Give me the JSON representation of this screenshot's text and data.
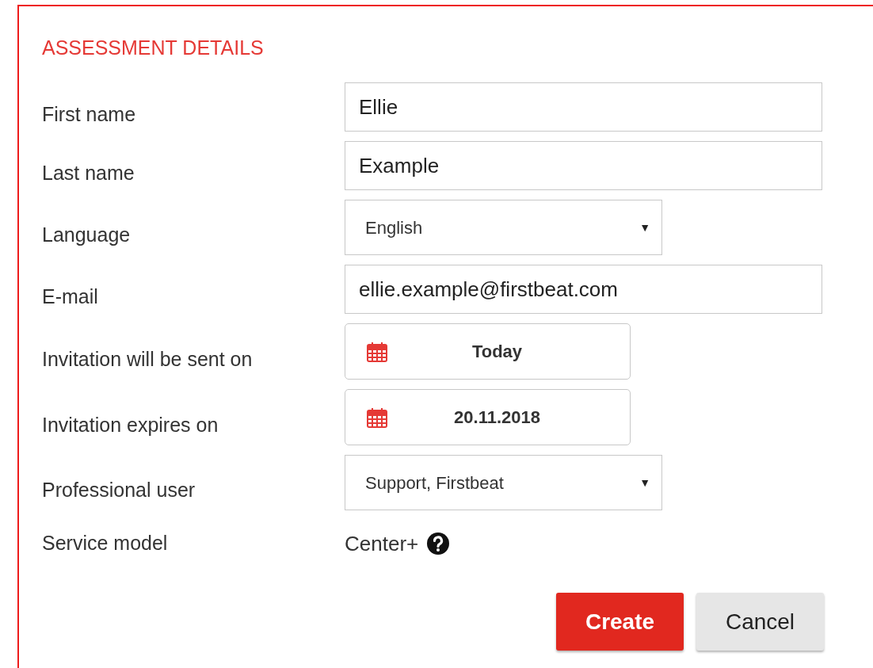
{
  "title": "ASSESSMENT DETAILS",
  "fields": [
    {
      "kind": "text",
      "label": "First name",
      "value": "Ellie"
    },
    {
      "kind": "text",
      "label": "Last name",
      "value": "Example"
    },
    {
      "kind": "select",
      "label": "Language",
      "value": "English",
      "arrow": "▼"
    },
    {
      "kind": "text",
      "label": "E-mail",
      "value": "ellie.example@firstbeat.com"
    },
    {
      "kind": "date",
      "label": "Invitation will be sent on",
      "value": "Today"
    },
    {
      "kind": "date",
      "label": "Invitation expires on",
      "value": "20.11.2018"
    },
    {
      "kind": "select",
      "label": "Professional user",
      "value": "Support, Firstbeat",
      "arrow": "▼"
    },
    {
      "kind": "info",
      "label": "Service model",
      "value": "Center+"
    }
  ],
  "buttons": [
    {
      "label": "Create",
      "primary": true
    },
    {
      "label": "Cancel",
      "primary": false
    }
  ]
}
